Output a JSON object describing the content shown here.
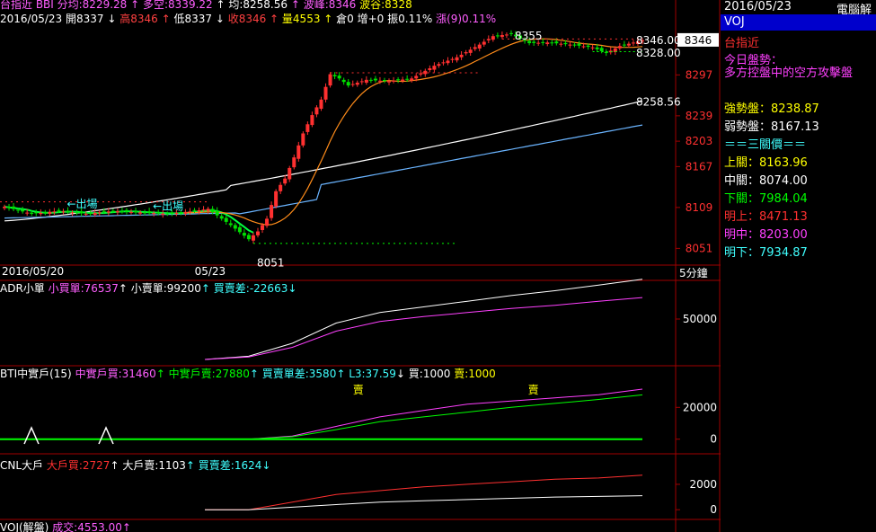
{
  "header": {
    "line1": [
      {
        "t": "台指近 BBI 分均:8229.28 ",
        "c": "#ff5fff"
      },
      {
        "t": "↑ 多空:8339.22 ",
        "c": "#ff5fff"
      },
      {
        "t": "↑ 均:8258.56 ",
        "c": "#ffffff"
      },
      {
        "t": "↑ 波峰:8346 ",
        "c": "#ff5fff"
      },
      {
        "t": "波谷:8328",
        "c": "#ffff00"
      }
    ],
    "line2": [
      {
        "t": "2016/05/23 ",
        "c": "#ffffff"
      },
      {
        "t": "開8337 ",
        "c": "#ffffff"
      },
      {
        "t": "↓ ",
        "c": "#ffffff"
      },
      {
        "t": "高8346 ",
        "c": "#ff4040"
      },
      {
        "t": "↑ ",
        "c": "#ff4040"
      },
      {
        "t": "低8337 ",
        "c": "#ffffff"
      },
      {
        "t": "↓ ",
        "c": "#ffffff"
      },
      {
        "t": "收8346 ",
        "c": "#ff4040"
      },
      {
        "t": "↑ ",
        "c": "#ff4040"
      },
      {
        "t": "量4553 ",
        "c": "#ffff00"
      },
      {
        "t": "↑ ",
        "c": "#ffff00"
      },
      {
        "t": "倉0 增+0 ",
        "c": "#ffffff"
      },
      {
        "t": "振0.11% ",
        "c": "#ffffff"
      },
      {
        "t": "漲(9)0.11%",
        "c": "#ff5fff"
      }
    ]
  },
  "sidebar": {
    "date": "2016/05/23",
    "source": "電腦解",
    "code": "VOJ",
    "instrument": "台指近",
    "trend_title": "今日盤勢：",
    "trend_text": "多方控盤中的空方攻擊盤",
    "strong_label": "強勢盤：",
    "strong_value": "8238.87",
    "weak_label": "弱勢盤：",
    "weak_value": "8167.13",
    "three_title": "＝＝三關價＝＝",
    "levels": [
      {
        "label": "上關：",
        "value": "8163.96",
        "color": "#ffff00"
      },
      {
        "label": "中關：",
        "value": "8074.00",
        "color": "#ffffff"
      },
      {
        "label": "下關：",
        "value": "7984.04",
        "color": "#00ff00"
      },
      {
        "label": "明上：",
        "value": "8471.13",
        "color": "#ff3030"
      },
      {
        "label": "明中：",
        "value": "8203.00",
        "color": "#ff40ff"
      },
      {
        "label": "明下：",
        "value": "7934.87",
        "color": "#40ffff"
      }
    ]
  },
  "panels": {
    "adr": [
      {
        "t": "ADR小單 ",
        "c": "#ffffff"
      },
      {
        "t": "小買單:76537",
        "c": "#ff5fff"
      },
      {
        "t": "↑ 小賣單:99200",
        "c": "#ffffff"
      },
      {
        "t": "↑ 買賣差:-22663",
        "c": "#40ffff"
      },
      {
        "t": "↓",
        "c": "#40ffff"
      }
    ],
    "bti": [
      {
        "t": "BTI中實戶(15) ",
        "c": "#ffffff"
      },
      {
        "t": "中實戶買:31460",
        "c": "#ff5fff"
      },
      {
        "t": "↑ 中實戶賣:27880",
        "c": "#00ff00"
      },
      {
        "t": "↑ 買賣單差:3580",
        "c": "#40ffff"
      },
      {
        "t": "↑ L3:37.59",
        "c": "#40ffff"
      },
      {
        "t": "↓ 買:1000",
        "c": "#ffffff"
      },
      {
        "t": " 賣:1000",
        "c": "#ffff00"
      }
    ],
    "cnl": [
      {
        "t": "CNL大戶 ",
        "c": "#ffffff"
      },
      {
        "t": "大戶買:2727",
        "c": "#ff3030"
      },
      {
        "t": "↑ 大戶賣:1103",
        "c": "#ffffff"
      },
      {
        "t": "↑ 買賣差:1624",
        "c": "#40ffff"
      },
      {
        "t": "↓",
        "c": "#40ffff"
      }
    ],
    "voj": [
      {
        "t": "VOJ(解盤) ",
        "c": "#ffffff"
      },
      {
        "t": "成交:4553.00",
        "c": "#ff5fff"
      },
      {
        "t": "↑",
        "c": "#ff5fff"
      }
    ]
  },
  "chart_data": [
    {
      "type": "candlestick",
      "title": "台指近 5分鐘",
      "timeframe": "5分鐘",
      "x_labels": [
        {
          "label": "2016/05/20",
          "index": 0
        },
        {
          "label": "05/23",
          "index": 45
        }
      ],
      "yticks": [
        8346,
        8297,
        8239,
        8203,
        8167,
        8109,
        8051
      ],
      "ylim": [
        8040,
        8365
      ],
      "last_price": "8346",
      "annotations": [
        {
          "text": "8355",
          "index": 112,
          "price": 8355
        },
        {
          "text": "8051",
          "index": 55,
          "price": 8051
        },
        {
          "text": "8346.00",
          "index": 141,
          "price": 8346
        },
        {
          "text": "8328.00",
          "index": 141,
          "price": 8328
        },
        {
          "text": "8258.56",
          "index": 141,
          "price": 8258.56
        },
        {
          "text": "←出場",
          "index": 13,
          "price": 8114
        },
        {
          "text": "←出場",
          "index": 32,
          "price": 8111
        }
      ],
      "series_desc": {
        "orange": "多空",
        "blue": "分均",
        "white": "均",
        "green": "BBI"
      },
      "path_points": [
        [
          0,
          8110
        ],
        [
          6,
          8100
        ],
        [
          12,
          8104
        ],
        [
          18,
          8100
        ],
        [
          24,
          8104
        ],
        [
          30,
          8102
        ],
        [
          36,
          8100
        ],
        [
          42,
          8104
        ],
        [
          45,
          8107
        ],
        [
          50,
          8084
        ],
        [
          54,
          8064
        ],
        [
          56,
          8075
        ],
        [
          58,
          8093
        ],
        [
          60,
          8132
        ],
        [
          62,
          8150
        ],
        [
          64,
          8180
        ],
        [
          66,
          8214
        ],
        [
          68,
          8240
        ],
        [
          70,
          8262
        ],
        [
          72,
          8298
        ],
        [
          74,
          8292
        ],
        [
          76,
          8282
        ],
        [
          80,
          8290
        ],
        [
          85,
          8288
        ],
        [
          90,
          8292
        ],
        [
          95,
          8310
        ],
        [
          100,
          8322
        ],
        [
          105,
          8340
        ],
        [
          108,
          8352
        ],
        [
          112,
          8355
        ],
        [
          116,
          8342
        ],
        [
          120,
          8343
        ],
        [
          125,
          8340
        ],
        [
          130,
          8336
        ],
        [
          133,
          8328
        ],
        [
          136,
          8338
        ],
        [
          141,
          8346
        ]
      ]
    },
    {
      "type": "line",
      "title": "ADR小單",
      "yticks": [
        50000
      ],
      "ylim": [
        0,
        80000
      ],
      "series": [
        {
          "name": "小賣單",
          "values": [
            0,
            4000,
            20000,
            45000,
            58000,
            65000,
            72000,
            79000,
            85000,
            92000,
            99200
          ]
        },
        {
          "name": "小買單",
          "values": [
            0,
            3000,
            15000,
            35000,
            47000,
            53000,
            58000,
            63000,
            67000,
            72000,
            76537
          ]
        }
      ]
    },
    {
      "type": "line",
      "title": "BTI中實戶(15)",
      "yticks": [
        20000,
        0
      ],
      "ylim": [
        -3000,
        36000
      ],
      "series": [
        {
          "name": "中實戶買",
          "values": [
            0,
            0,
            2000,
            8000,
            14000,
            18000,
            22000,
            24000,
            26000,
            28000,
            31460
          ]
        },
        {
          "name": "中實戶賣",
          "values": [
            0,
            0,
            1500,
            6000,
            11000,
            14000,
            17000,
            20000,
            22500,
            25000,
            27880
          ]
        }
      ],
      "markers": [
        {
          "text": "賣",
          "index": 4
        },
        {
          "text": "賣",
          "index": 8
        }
      ]
    },
    {
      "type": "line",
      "title": "CNL大戶",
      "yticks": [
        2000,
        0
      ],
      "ylim": [
        -200,
        3200
      ],
      "series": [
        {
          "name": "大戶買",
          "values": [
            0,
            0,
            600,
            1200,
            1500,
            1800,
            2000,
            2200,
            2400,
            2500,
            2727
          ]
        },
        {
          "name": "大戶賣",
          "values": [
            0,
            0,
            200,
            400,
            600,
            700,
            800,
            900,
            1000,
            1050,
            1103
          ]
        }
      ]
    }
  ]
}
